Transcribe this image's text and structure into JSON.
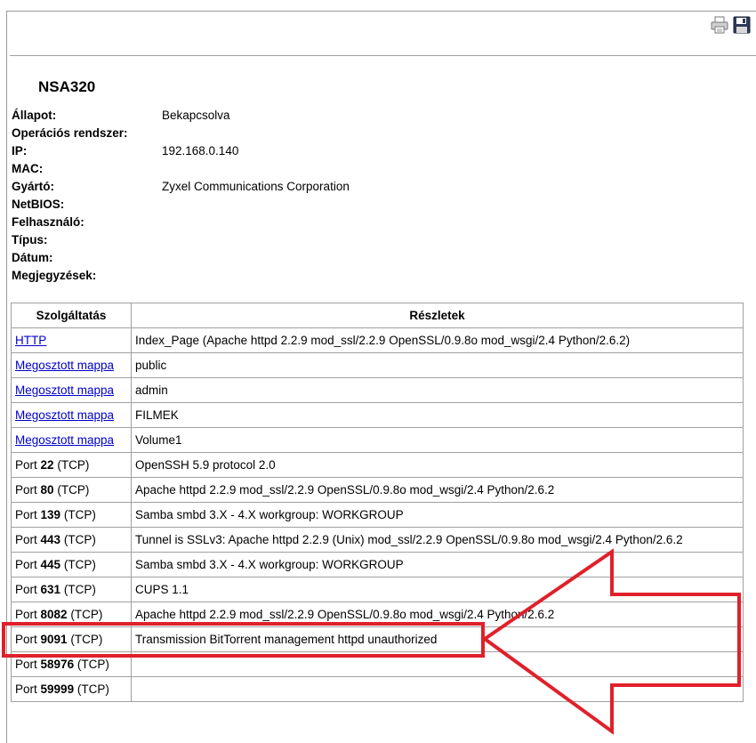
{
  "toolbar": {
    "icons": [
      "printer-icon",
      "floppy-disk-save-icon"
    ]
  },
  "device": {
    "title": "NSA320",
    "fields": [
      {
        "label": "Állapot:",
        "value": "Bekapcsolva"
      },
      {
        "label": "Operációs rendszer:",
        "value": ""
      },
      {
        "label": "IP:",
        "value": "192.168.0.140"
      },
      {
        "label": "MAC:",
        "value": ""
      },
      {
        "label": "Gyártó:",
        "value": "Zyxel Communications Corporation"
      },
      {
        "label": "NetBIOS:",
        "value": ""
      },
      {
        "label": "Felhasználó:",
        "value": ""
      },
      {
        "label": "Típus:",
        "value": ""
      },
      {
        "label": "Dátum:",
        "value": ""
      },
      {
        "label": "Megjegyzések:",
        "value": ""
      }
    ]
  },
  "services": {
    "headers": {
      "service": "Szolgáltatás",
      "details": "Részletek"
    },
    "link_rows": [
      {
        "service": "HTTP",
        "details": "Index_Page (Apache httpd 2.2.9 mod_ssl/2.2.9 OpenSSL/0.9.8o mod_wsgi/2.4 Python/2.6.2)"
      },
      {
        "service": "Megosztott mappa",
        "details": "public"
      },
      {
        "service": "Megosztott mappa",
        "details": "admin"
      },
      {
        "service": "Megosztott mappa",
        "details": "FILMEK"
      },
      {
        "service": "Megosztott mappa",
        "details": "Volume1"
      }
    ],
    "port_prefix": "Port",
    "port_rows": [
      {
        "port": "22",
        "proto": "(TCP)",
        "details": "OpenSSH 5.9 protocol 2.0"
      },
      {
        "port": "80",
        "proto": "(TCP)",
        "details": "Apache httpd 2.2.9 mod_ssl/2.2.9 OpenSSL/0.9.8o mod_wsgi/2.4 Python/2.6.2"
      },
      {
        "port": "139",
        "proto": "(TCP)",
        "details": "Samba smbd 3.X - 4.X workgroup: WORKGROUP"
      },
      {
        "port": "443",
        "proto": "(TCP)",
        "details": "Tunnel is SSLv3: Apache httpd 2.2.9 (Unix) mod_ssl/2.2.9 OpenSSL/0.9.8o mod_wsgi/2.4 Python/2.6.2"
      },
      {
        "port": "445",
        "proto": "(TCP)",
        "details": "Samba smbd 3.X - 4.X workgroup: WORKGROUP"
      },
      {
        "port": "631",
        "proto": "(TCP)",
        "details": "CUPS 1.1"
      },
      {
        "port": "8082",
        "proto": "(TCP)",
        "details": "Apache httpd 2.2.9 mod_ssl/2.2.9 OpenSSL/0.9.8o mod_wsgi/2.4 Python/2.6.2"
      },
      {
        "port": "9091",
        "proto": "(TCP)",
        "details": "Transmission BitTorrent management httpd unauthorized"
      },
      {
        "port": "58976",
        "proto": "(TCP)",
        "details": ""
      },
      {
        "port": "59999",
        "proto": "(TCP)",
        "details": ""
      }
    ]
  },
  "annotation": {
    "color": "#e0202a",
    "highlighted_port": "9091"
  }
}
